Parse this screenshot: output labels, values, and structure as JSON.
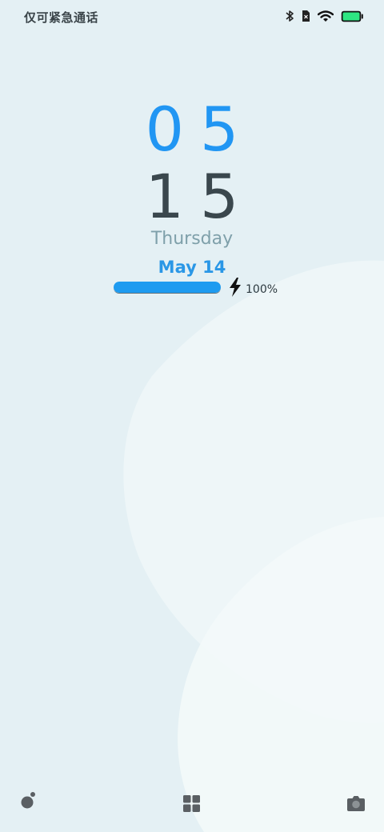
{
  "status_bar": {
    "carrier_text": "仅可紧急通话",
    "icons": [
      "bluetooth-icon",
      "sim-card-icon",
      "wifi-icon",
      "battery-icon"
    ],
    "battery_color": "#2ee582"
  },
  "clock": {
    "hour": "05",
    "minute": "15",
    "weekday": "Thursday",
    "date": "May 14"
  },
  "battery": {
    "level": 1.0,
    "percent_label": "100%",
    "charging": true,
    "fill_color": "#1e9bf0"
  },
  "bottom_bar": {
    "left_icon": "music-note-icon",
    "center_icon": "grid-icon",
    "right_icon": "camera-icon"
  },
  "colors": {
    "background": "#e4f0f4",
    "hour_color": "#2196f3",
    "minute_color": "#3a474d",
    "weekday_color": "#7fa0aa",
    "date_color": "#2a97e6"
  }
}
